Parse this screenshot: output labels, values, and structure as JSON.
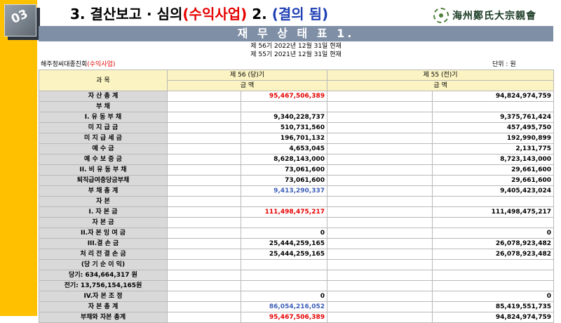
{
  "slide": {
    "number": "03",
    "title_prefix": "3. 결산보고 · 심의",
    "title_highlight": "(수익사업)",
    "title_mid": " 2. ",
    "title_status": "(결의 됨)",
    "logo_text": "海州鄭氏大宗親會"
  },
  "report": {
    "banner": "재 무 상 태 표 1.",
    "period_current": "제  56기  2022년 12월 31일 현재",
    "period_previous": "제  55기  2021년 12월 31일 현재",
    "org_name": "해주정씨대종친회",
    "org_highlight": "(수익사업)",
    "unit": "단위 : 원"
  },
  "table": {
    "header_item": "과          목",
    "header_current": "제  56 (당)기",
    "header_previous": "제  55 (전)기",
    "header_amount": "금                    액",
    "rows": [
      {
        "label": "자     산     총     계",
        "cur_left": "",
        "cur_right": "95,467,506,389",
        "prev_left": "",
        "prev_right": "94,824,974,759",
        "cur_color": "red"
      },
      {
        "label": "부               채",
        "cur_left": "",
        "cur_right": "",
        "prev_left": "",
        "prev_right": "",
        "cur_color": ""
      },
      {
        "label": "I. 유   동   부   채",
        "cur_left": "",
        "cur_right": "9,340,228,737",
        "prev_left": "",
        "prev_right": "9,375,761,424",
        "cur_color": ""
      },
      {
        "label": "미     지     급     금",
        "cur_left": "",
        "cur_right": "510,731,560",
        "prev_left": "",
        "prev_right": "457,495,750",
        "cur_color": ""
      },
      {
        "label": "미  지  급  세  금",
        "cur_left": "",
        "cur_right": "196,701,132",
        "prev_left": "",
        "prev_right": "192,990,899",
        "cur_color": ""
      },
      {
        "label": "예        수        금",
        "cur_left": "",
        "cur_right": "4,653,045",
        "prev_left": "",
        "prev_right": "2,131,775",
        "cur_color": ""
      },
      {
        "label": "예  수  보  증  금",
        "cur_left": "",
        "cur_right": "8,628,143,000",
        "prev_left": "",
        "prev_right": "8,723,143,000",
        "cur_color": ""
      },
      {
        "label": "II. 비  유  동  부  채",
        "cur_left": "",
        "cur_right": "73,061,600",
        "prev_left": "",
        "prev_right": "29,661,600",
        "cur_color": ""
      },
      {
        "label": "퇴직급여충당금부채",
        "cur_left": "",
        "cur_right": "73,061,600",
        "prev_left": "",
        "prev_right": "29,661,600",
        "cur_color": ""
      },
      {
        "label": "부     채     총     계",
        "cur_left": "",
        "cur_right": "9,413,290,337",
        "prev_left": "",
        "prev_right": "9,405,423,024",
        "cur_color": "blue"
      },
      {
        "label": "자               본",
        "cur_left": "",
        "cur_right": "",
        "prev_left": "",
        "prev_right": "",
        "cur_color": ""
      },
      {
        "label": "I. 자      본      금",
        "cur_left": "",
        "cur_right": "111,498,475,217",
        "prev_left": "",
        "prev_right": "111,498,475,217",
        "cur_color": "red"
      },
      {
        "label": "자       본       금",
        "cur_left": "",
        "cur_right": "",
        "prev_left": "",
        "prev_right": "",
        "cur_color": ""
      },
      {
        "label": "II.자  본  잉  여  금",
        "cur_left": "",
        "cur_right": "0",
        "prev_left": "",
        "prev_right": "0",
        "cur_color": ""
      },
      {
        "label": "III.결      손      금",
        "cur_left": "",
        "cur_right": "25,444,259,165",
        "prev_left": "",
        "prev_right": "26,078,923,482",
        "cur_color": ""
      },
      {
        "label": "처  리  전  결  손  금",
        "cur_left": "",
        "cur_right": "25,444,259,165",
        "prev_left": "",
        "prev_right": "26,078,923,482",
        "cur_color": ""
      },
      {
        "label": "(당  기  순  이  익)",
        "cur_left": "",
        "cur_right": "",
        "prev_left": "",
        "prev_right": "",
        "cur_color": ""
      },
      {
        "label": "당기:    634,664,317 원",
        "cur_left": "",
        "cur_right": "",
        "prev_left": "",
        "prev_right": "",
        "cur_color": ""
      },
      {
        "label": "전기: 13,756,154,165원",
        "cur_left": "",
        "cur_right": "",
        "prev_left": "",
        "prev_right": "",
        "cur_color": ""
      },
      {
        "label": "IV.자    본    조    정",
        "cur_left": "",
        "cur_right": "0",
        "prev_left": "",
        "prev_right": "0",
        "cur_color": ""
      },
      {
        "label": "자     본     총     계",
        "cur_left": "",
        "cur_right": "86,054,216,052",
        "prev_left": "",
        "prev_right": "85,419,551,735",
        "cur_color": "blue"
      },
      {
        "label": "부채와 자본 총계",
        "cur_left": "",
        "cur_right": "95,467,506,389",
        "prev_left": "",
        "prev_right": "94,824,974,759",
        "cur_color": "red"
      }
    ]
  },
  "colors": {
    "accent_bar": "#ffc000",
    "banner": "#7f8fa6",
    "header_fill": "#fbf3c2",
    "label_fill": "#d9d9d9",
    "highlight_red": "#e60000",
    "highlight_blue": "#3a5cb8"
  }
}
